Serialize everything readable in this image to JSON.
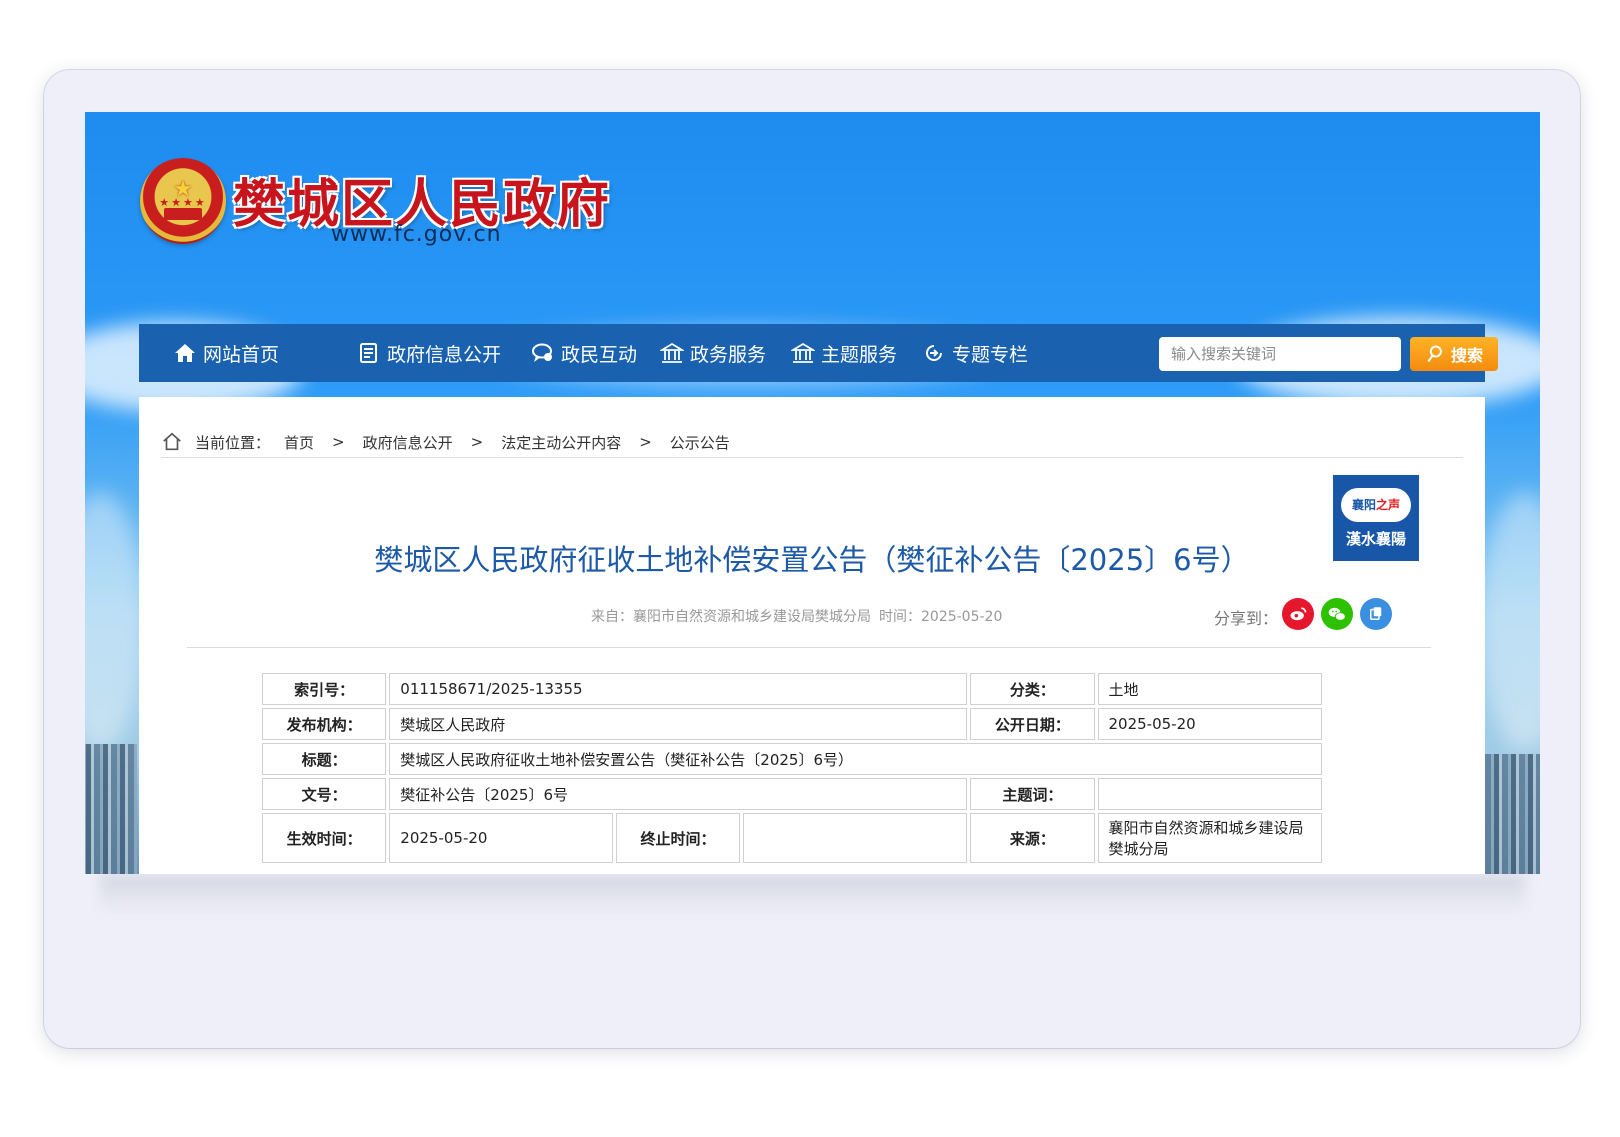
{
  "site": {
    "title": "樊城区人民政府",
    "url": "www.fc.gov.cn"
  },
  "nav": {
    "items": [
      {
        "label": "网站首页",
        "icon": "home-icon"
      },
      {
        "label": "政府信息公开",
        "icon": "document-icon"
      },
      {
        "label": "政民互动",
        "icon": "chat-icon"
      },
      {
        "label": "政务服务",
        "icon": "building-icon"
      },
      {
        "label": "主题服务",
        "icon": "building-icon"
      },
      {
        "label": "专题专栏",
        "icon": "refresh-icon"
      }
    ],
    "search_placeholder": "输入搜索关键词",
    "search_button": "搜索"
  },
  "breadcrumb": {
    "prefix": "当前位置：",
    "items": [
      "首页",
      "政府信息公开",
      "法定主动公开内容",
      "公示公告"
    ],
    "separator": ">"
  },
  "badge": {
    "top": "襄阳",
    "top_accent": "之声",
    "slogan": "漢水襄陽"
  },
  "article": {
    "title": "樊城区人民政府征收土地补偿安置公告（樊征补公告〔2025〕6号）",
    "source": "来自：襄阳市自然资源和城乡建设局樊城分局",
    "time": "时间：2025-05-20",
    "share_label": "分享到："
  },
  "info_table": {
    "index_label": "索引号：",
    "index_value": "011158671/2025-13355",
    "category_label": "分类：",
    "category_value": "土地",
    "issuer_label": "发布机构：",
    "issuer_value": "樊城区人民政府",
    "pubdate_label": "公开日期：",
    "pubdate_value": "2025-05-20",
    "title_label": "标题：",
    "title_value": "樊城区人民政府征收土地补偿安置公告（樊征补公告〔2025〕6号）",
    "docno_label": "文号：",
    "docno_value": "樊征补公告〔2025〕6号",
    "keywords_label": "主题词：",
    "keywords_value": "",
    "effective_label": "生效时间：",
    "effective_value": "2025-05-20",
    "end_label": "终止时间：",
    "end_value": "",
    "source_label": "来源：",
    "source_value": "襄阳市自然资源和城乡建设局樊城分局"
  },
  "colors": {
    "nav_bg": "#1a62b0",
    "title_blue": "#1c59a7",
    "search_orange": "#f48b0e",
    "weibo_red": "#e6162d",
    "wechat_green": "#2dc100",
    "copy_blue": "#3a8fe0"
  }
}
